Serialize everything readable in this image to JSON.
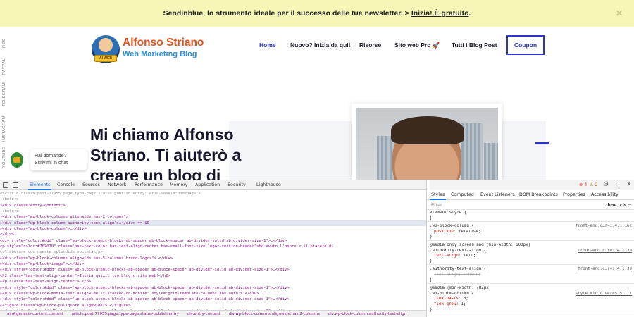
{
  "promo": {
    "text": "Sendinblue, lo strumento ideale per il successo delle tue newsletter. >",
    "link": "Inizia! È gratuito",
    "end": ".",
    "close": "✕"
  },
  "logo": {
    "name": "Alfonso Striano",
    "subtitle": "Web Marketing Blog",
    "badge": "AI WEB"
  },
  "nav": {
    "items": [
      "Home",
      "Nuovo? Inizia da qui!",
      "Risorse",
      "Sito web Pro 🚀",
      "Tutti i Blog Post"
    ],
    "coupon": "Coupon"
  },
  "social": [
    "RSS",
    "PAYPAL",
    "TELEGRAM",
    "INSTAGRAM",
    "YOUTUBE",
    "TWITTER"
  ],
  "hero": {
    "title": "Mi chiamo Alfonso Striano. Ti aiuterò a creare un blog di"
  },
  "chat": {
    "text": "Hai domande? Scrivimi in chat"
  },
  "devtools": {
    "tabs": [
      "Elements",
      "Console",
      "Sources",
      "Network",
      "Performance",
      "Memory",
      "Application",
      "Security",
      "Lighthouse"
    ],
    "errors": "4",
    "warnings": "2",
    "code_lines": [
      {
        "text": "      <article class=\"post-77955 page type-page status-publish entry\" aria-label=\"Homepage\">",
        "cls": "dim"
      },
      {
        "text": "        ::before",
        "cls": "dim"
      },
      {
        "text": "      ▾<div class=\"entry-content\">",
        "cls": ""
      },
      {
        "text": "          ::before",
        "cls": "dim"
      },
      {
        "text": "        ▾<div class=\"wp-block-columns alignwide has-2-columns\">",
        "cls": ""
      },
      {
        "text": "          ▸<div class=\"wp-block-column authority-text-align\">…</div> == $0",
        "cls": "sel"
      },
      {
        "text": "          ▸<div class=\"wp-block-column\">…</div>",
        "cls": ""
      },
      {
        "text": "          </div>",
        "cls": ""
      },
      {
        "text": "          <div style=\"color:#ddd\" class=\"wp-block-atomic-blocks-ab-spacer ab-block-spacer ab-divider-solid ab-divider-size-1\">…</div>",
        "cls": ""
      },
      {
        "text": "          <p style=\"color:#707070\" class=\"has-text-color has-text-align-center has-small-font-size logos-section-header\">Ho avuto l'onore e il piacere di",
        "cls": ""
      },
      {
        "text": "          collaborare con queste splendide società</p>",
        "cls": "dim"
      },
      {
        "text": "        ▸<div class=\"wp-block-columns alignwide has-5-columns brand-logos\">…</div>",
        "cls": ""
      },
      {
        "text": "        ▸<div class=\"wp-block-image\">…</div>",
        "cls": ""
      },
      {
        "text": "        ▸<div style=\"color:#ddd\" class=\"wp-block-atomic-blocks-ab-spacer ab-block-spacer ab-divider-solid ab-divider-size-1\">…</div>",
        "cls": ""
      },
      {
        "text": "          <h2 class=\"has-text-align-center\">Inizia qui…il tuo blog o sito web!</h2>",
        "cls": ""
      },
      {
        "text": "        ▸<p class=\"has-text-align-center\">…</p>",
        "cls": ""
      },
      {
        "text": "        ▸<div style=\"color:#ddd\" class=\"wp-block-atomic-blocks-ab-spacer ab-block-spacer ab-divider-solid ab-divider-size-1\">…</div>",
        "cls": ""
      },
      {
        "text": "        ▸<div class=\"wp-block-media-text alignwide is-stacked-on-mobile\" style=\"grid-template-columns:38% auto\">…</div>",
        "cls": ""
      },
      {
        "text": "        ▸<div style=\"color:#ddd\" class=\"wp-block-atomic-blocks-ab-spacer ab-block-spacer ab-divider-solid ab-divider-size-1\">…</div>",
        "cls": ""
      },
      {
        "text": "        ▸<figure class=\"wp-block-pullquote alignwide\">…</figure>",
        "cls": ""
      },
      {
        "text": "        ▸<div style=\"color:#ddd\" class=\"wp-block-atomic-blocks-ab-spacer ab-block-spacer ab-divider-solid ab-divider-size-1\">…</div>",
        "cls": ""
      }
    ],
    "breadcrumbs": [
      "ain#genesis-content.content",
      "article.post-77955.page.type-page.status-publish.entry",
      "div.entry-content",
      "div.wp-block-columns.alignwide.has-2-columns",
      "div.wp-block-column.authority-text-align"
    ],
    "styles": {
      "tabs": [
        "Styles",
        "Computed",
        "Event Listeners",
        "DOM Breakpoints",
        "Properties",
        "Accessibility"
      ],
      "filter_placeholder": "Filter",
      "filter_buttons": ":hov  .cls  +",
      "rules": [
        {
          "lines": [
            "element.style {",
            "}"
          ],
          "props": [],
          "source": ""
        },
        {
          "lines": [
            ".wp-block-column {"
          ],
          "props": [
            {
              "p": "position",
              "v": "relative;",
              "strike": false
            }
          ],
          "source": "front-end.c…r=1.4.1:162"
        },
        {
          "lines": [
            "@media only screen and (min-width: 600px)",
            ".authority-text-align {"
          ],
          "props": [
            {
              "p": "text-align",
              "v": "left;",
              "strike": false
            }
          ],
          "source": "front-end.c…r=1.4.1:39"
        },
        {
          "lines": [
            ".authority-text-align {"
          ],
          "props": [
            {
              "p": "text-align",
              "v": "center;",
              "strike": true
            }
          ],
          "source": "front-end.c…r=1.4.1:39"
        },
        {
          "lines": [
            "@media (min-width: 782px)",
            ".wp-block-column {"
          ],
          "props": [
            {
              "p": "flex-basis",
              "v": "0;",
              "strike": false
            },
            {
              "p": "flex-grow",
              "v": "1;",
              "strike": false
            }
          ],
          "source": "style.min.c…ver=5.5.1:1"
        }
      ]
    }
  }
}
